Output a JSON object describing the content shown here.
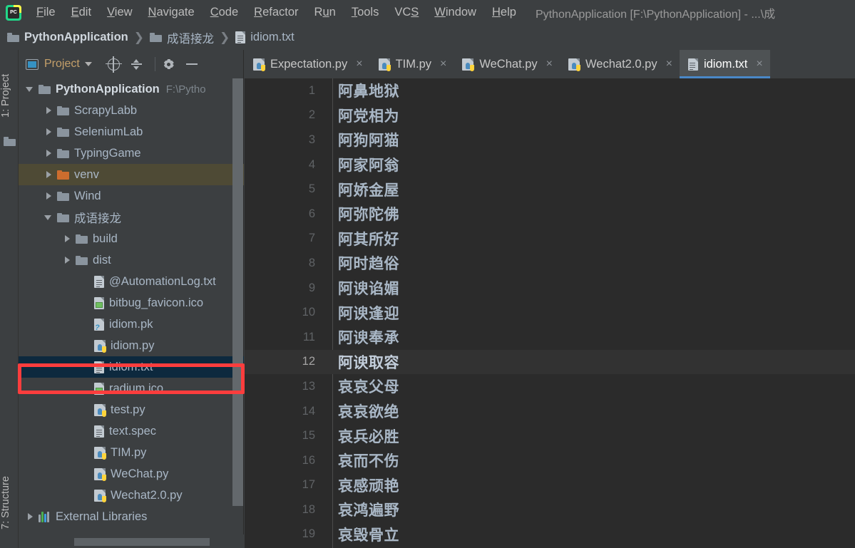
{
  "window": {
    "title": "PythonApplication [F:\\PythonApplication] - ...\\成"
  },
  "menu": {
    "items": [
      {
        "label": "File",
        "mnemonic": "F"
      },
      {
        "label": "Edit",
        "mnemonic": "E"
      },
      {
        "label": "View",
        "mnemonic": "V"
      },
      {
        "label": "Navigate",
        "mnemonic": "N"
      },
      {
        "label": "Code",
        "mnemonic": "C"
      },
      {
        "label": "Refactor",
        "mnemonic": "R"
      },
      {
        "label": "Run",
        "mnemonic": "u"
      },
      {
        "label": "Tools",
        "mnemonic": "T"
      },
      {
        "label": "VCS",
        "mnemonic": "S"
      },
      {
        "label": "Window",
        "mnemonic": "W"
      },
      {
        "label": "Help",
        "mnemonic": "H"
      }
    ]
  },
  "breadcrumb": {
    "items": [
      {
        "label": "PythonApplication",
        "icon": "folder-icon"
      },
      {
        "label": "成语接龙",
        "icon": "folder-icon"
      },
      {
        "label": "idiom.txt",
        "icon": "text-file-icon"
      }
    ],
    "separator": "❯"
  },
  "left_strip": {
    "project_tab": "1: Project",
    "structure_tab": "7: Structure"
  },
  "project_panel": {
    "toolbar": {
      "title": "Project",
      "dropdown_icon": "chevron-down-icon",
      "locate_icon": "target-icon",
      "collapse_icon": "collapse-all-icon",
      "settings_icon": "gear-icon",
      "hide_icon": "minimize-icon"
    },
    "tree": [
      {
        "label": "PythonApplication",
        "path": "F:\\Pytho",
        "icon": "folder-icon",
        "indent": 0,
        "twisty": "open",
        "bold": true,
        "state": "normal"
      },
      {
        "label": "ScrapyLabb",
        "icon": "folder-icon",
        "indent": 1,
        "twisty": "closed",
        "state": "normal"
      },
      {
        "label": "SeleniumLab",
        "icon": "folder-icon",
        "indent": 1,
        "twisty": "closed",
        "state": "normal"
      },
      {
        "label": "TypingGame",
        "icon": "folder-icon",
        "indent": 1,
        "twisty": "closed",
        "state": "normal"
      },
      {
        "label": "venv",
        "icon": "folder-orange-icon",
        "indent": 1,
        "twisty": "closed",
        "state": "highlighted"
      },
      {
        "label": "Wind",
        "icon": "folder-icon",
        "indent": 1,
        "twisty": "closed",
        "state": "normal"
      },
      {
        "label": "成语接龙",
        "icon": "folder-icon",
        "indent": 1,
        "twisty": "open",
        "state": "normal"
      },
      {
        "label": "build",
        "icon": "folder-icon",
        "indent": 2,
        "twisty": "closed",
        "state": "normal"
      },
      {
        "label": "dist",
        "icon": "folder-icon",
        "indent": 2,
        "twisty": "closed",
        "state": "normal"
      },
      {
        "label": "@AutomationLog.txt",
        "icon": "text-file-icon",
        "indent": 3,
        "twisty": "none",
        "state": "normal"
      },
      {
        "label": "bitbug_favicon.ico",
        "icon": "image-file-icon",
        "indent": 3,
        "twisty": "none",
        "state": "normal"
      },
      {
        "label": "idiom.pk",
        "icon": "unknown-file-icon",
        "indent": 3,
        "twisty": "none",
        "state": "normal"
      },
      {
        "label": "idiom.py",
        "icon": "python-file-icon",
        "indent": 3,
        "twisty": "none",
        "state": "normal"
      },
      {
        "label": "idiom.txt",
        "icon": "text-file-icon",
        "indent": 3,
        "twisty": "none",
        "state": "selected"
      },
      {
        "label": "radium.ico",
        "icon": "image-file-icon",
        "indent": 3,
        "twisty": "none",
        "state": "normal"
      },
      {
        "label": "test.py",
        "icon": "python-file-icon",
        "indent": 3,
        "twisty": "none",
        "state": "normal"
      },
      {
        "label": "text.spec",
        "icon": "text-file-icon",
        "indent": 3,
        "twisty": "none",
        "state": "normal"
      },
      {
        "label": "TIM.py",
        "icon": "python-file-icon",
        "indent": 3,
        "twisty": "none",
        "state": "normal"
      },
      {
        "label": "WeChat.py",
        "icon": "python-file-icon",
        "indent": 3,
        "twisty": "none",
        "state": "normal"
      },
      {
        "label": "Wechat2.0.py",
        "icon": "python-file-icon",
        "indent": 3,
        "twisty": "none",
        "state": "normal"
      },
      {
        "label": "External Libraries",
        "icon": "libraries-icon",
        "indent": 0,
        "twisty": "closed",
        "state": "normal"
      }
    ]
  },
  "editor": {
    "tabs": [
      {
        "label": "Expectation.py",
        "icon": "python-file-icon",
        "active": false,
        "close": "×"
      },
      {
        "label": "TIM.py",
        "icon": "python-file-icon",
        "active": false,
        "close": "×"
      },
      {
        "label": "WeChat.py",
        "icon": "python-file-icon",
        "active": false,
        "close": "×"
      },
      {
        "label": "Wechat2.0.py",
        "icon": "python-file-icon",
        "active": false,
        "close": "×"
      },
      {
        "label": "idiom.txt",
        "icon": "text-file-icon",
        "active": true,
        "close": "×"
      }
    ],
    "current_line": 12,
    "lines": [
      {
        "n": "1",
        "text": "阿鼻地狱"
      },
      {
        "n": "2",
        "text": "阿党相为"
      },
      {
        "n": "3",
        "text": "阿狗阿猫"
      },
      {
        "n": "4",
        "text": "阿家阿翁"
      },
      {
        "n": "5",
        "text": "阿娇金屋"
      },
      {
        "n": "6",
        "text": "阿弥陀佛"
      },
      {
        "n": "7",
        "text": "阿其所好"
      },
      {
        "n": "8",
        "text": "阿时趋俗"
      },
      {
        "n": "9",
        "text": "阿谀谄媚"
      },
      {
        "n": "10",
        "text": "阿谀逢迎"
      },
      {
        "n": "11",
        "text": "阿谀奉承"
      },
      {
        "n": "12",
        "text": "阿谀取容"
      },
      {
        "n": "13",
        "text": "哀哀父母"
      },
      {
        "n": "14",
        "text": "哀哀欲绝"
      },
      {
        "n": "15",
        "text": "哀兵必胜"
      },
      {
        "n": "16",
        "text": "哀而不伤"
      },
      {
        "n": "17",
        "text": "哀感顽艳"
      },
      {
        "n": "18",
        "text": "哀鸿遍野"
      },
      {
        "n": "19",
        "text": "哀毁骨立"
      }
    ]
  },
  "annotation": {
    "color": "#fc3d3d",
    "target": "idiom.txt"
  },
  "colors": {
    "panel_bg": "#3c3f41",
    "editor_bg": "#2b2b2b",
    "selection": "#0d293e",
    "highlight": "#4e4a35",
    "accent": "#4a88c7",
    "text": "#a9b7c6"
  }
}
